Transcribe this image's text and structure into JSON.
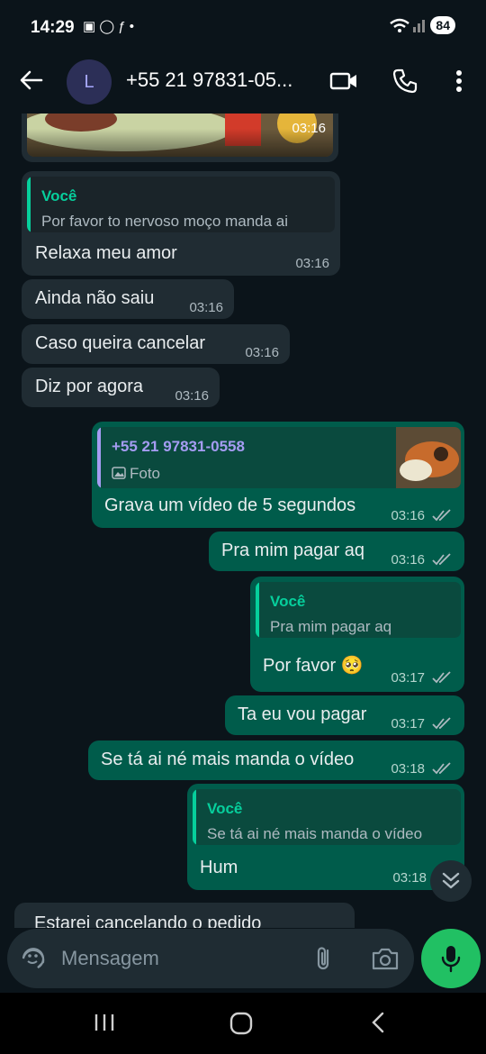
{
  "status_bar": {
    "time": "14:29",
    "notif_icons": "▣ ◯ ƒ •",
    "battery": "84"
  },
  "header": {
    "avatar_letter": "L",
    "contact_name": "+55 21 97831-05...",
    "icons": [
      "back-arrow-icon",
      "video-call-icon",
      "phone-icon",
      "more-vert-icon"
    ]
  },
  "messages": [
    {
      "dir": "in",
      "time": "03:16",
      "type": "image"
    },
    {
      "dir": "in",
      "quote_name": "Você",
      "quote_text": "Por favor to nervoso moço manda ai",
      "text": "Relaxa meu amor",
      "time": "03:16"
    },
    {
      "dir": "in",
      "text": "Ainda não saiu",
      "time": "03:16"
    },
    {
      "dir": "in",
      "text": "Caso queira cancelar",
      "time": "03:16"
    },
    {
      "dir": "in",
      "text": "Diz por agora",
      "time": "03:16"
    },
    {
      "dir": "out",
      "quote_name": "+55 21 97831-0558",
      "quote_text": "Foto",
      "text": "Grava um vídeo de 5 segundos",
      "time": "03:16"
    },
    {
      "dir": "out",
      "text": "Pra mim pagar aq",
      "time": "03:16"
    },
    {
      "dir": "out",
      "quote_name": "Você",
      "quote_text": "Pra mim pagar aq",
      "text": "Por favor 🥺",
      "time": "03:17"
    },
    {
      "dir": "out",
      "text": "Ta eu vou pagar",
      "time": "03:17"
    },
    {
      "dir": "out",
      "text": "Se tá ai né mais manda o vídeo",
      "time": "03:18"
    },
    {
      "dir": "out",
      "quote_name": "Você",
      "quote_text": "Se tá ai né mais manda o vídeo",
      "text": "Hum",
      "time": "03:18"
    },
    {
      "dir": "in",
      "text": "Estarei cancelando o pedido",
      "time": ""
    }
  ],
  "composer": {
    "placeholder": "Mensagem"
  },
  "colors": {
    "bg": "#0b141a",
    "incoming": "#202c33",
    "outgoing": "#005c4b",
    "accent": "#21c063",
    "quote_you": "#06cf9c",
    "quote_contact": "#a59cf2",
    "read_ticks": "#aebac1"
  }
}
